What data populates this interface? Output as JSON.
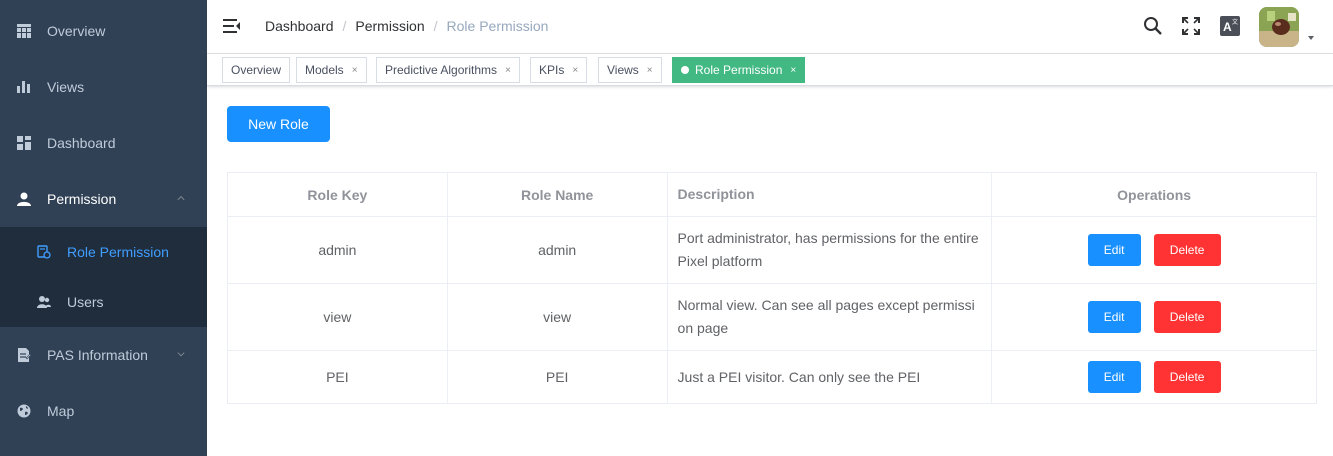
{
  "sidebar": {
    "items": [
      {
        "label": "Overview",
        "icon": "grid-table-icon"
      },
      {
        "label": "Views",
        "icon": "bar-chart-icon"
      },
      {
        "label": "Dashboard",
        "icon": "dashboard-icon"
      },
      {
        "label": "Permission",
        "icon": "user-icon"
      },
      {
        "label": "PAS Information",
        "icon": "document-icon"
      },
      {
        "label": "Map",
        "icon": "globe-icon"
      }
    ],
    "sub_items": [
      {
        "label": "Role Permission",
        "icon": "role-icon",
        "active": true
      },
      {
        "label": "Users",
        "icon": "users-icon"
      }
    ]
  },
  "breadcrumb": {
    "items": [
      "Dashboard",
      "Permission",
      "Role Permission"
    ],
    "separator": "/"
  },
  "tags": [
    {
      "label": "Overview"
    },
    {
      "label": "Models",
      "close": "×"
    },
    {
      "label": "Predictive Algorithms",
      "close": "×"
    },
    {
      "label": "KPIs",
      "close": "×"
    },
    {
      "label": "Views",
      "close": "×"
    },
    {
      "label": "Role Permission",
      "close": "×",
      "active": true
    }
  ],
  "main": {
    "new_role_label": "New Role",
    "table": {
      "headers": [
        "Role Key",
        "Role Name",
        "Description",
        "Operations"
      ],
      "rows": [
        {
          "key": "admin",
          "name": "admin",
          "description": "Port administrator, has permissions for the entire Pixel platform"
        },
        {
          "key": "view",
          "name": "view",
          "description": "Normal view. Can see all pages except permission page"
        },
        {
          "key": "PEI",
          "name": "PEI",
          "description": "Just a PEI visitor. Can only see the PEI"
        }
      ],
      "edit_label": "Edit",
      "delete_label": "Delete"
    }
  },
  "colors": {
    "sidebar_bg": "#304156",
    "active_text": "#409eff",
    "tag_active": "#42b983",
    "primary": "#1890ff",
    "danger": "#ff3333"
  }
}
